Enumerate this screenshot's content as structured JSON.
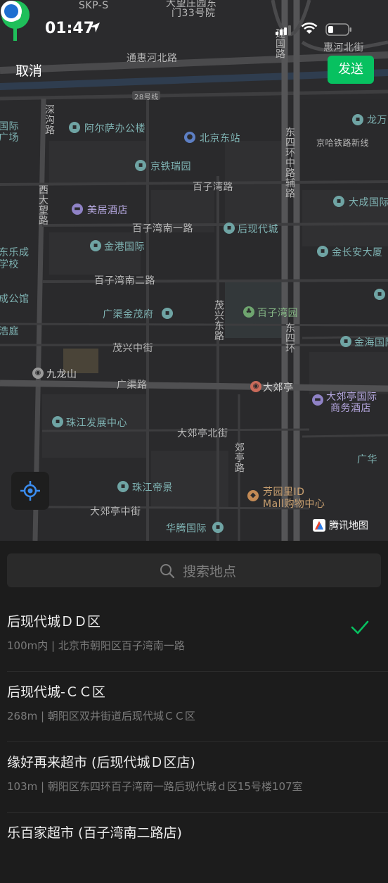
{
  "status_bar": {
    "time": "01:47"
  },
  "header": {
    "cancel_label": "取消",
    "send_label": "发送"
  },
  "map": {
    "logo_text": "腾讯地图",
    "labels": {
      "skp": "SKP-S",
      "dawang": "大望庄园东",
      "men33": "门33号院",
      "jianguo": "建国路",
      "huihe_top": "惠河北街",
      "tonghui": "通惠河北路",
      "line28": "28号线",
      "shengou": "深沟路",
      "guoji_left": "国际广场",
      "alsa": "阿尔萨办公楼",
      "bj_east": "北京东站",
      "dongsihuan_fu": "东四环中路辅路",
      "longwan": "龙万",
      "jingha": "京哈铁路新线",
      "jingtie": "京铁瑞园",
      "baiziwan": "百子湾路",
      "xidawang": "西大望路",
      "meiju": "美居酒店",
      "dacheng": "大成国际",
      "bzw_s1": "百子湾南一路",
      "houxiandai": "后现代城",
      "lecheng": "东乐成",
      "xuexiao": "学校",
      "jingang": "金港国际",
      "jinchang": "金长安大厦",
      "bzw_s2": "百子湾南二路",
      "gongguan": "成公馆",
      "guangqu_jinmao": "广渠金茂府",
      "maoxing_dong": "茂兴东路",
      "bzw_yuan": "百子湾园",
      "dongsihuan": "东四环",
      "haoting": "浩庭",
      "jinhai": "金海国际",
      "maoxing_zhong": "茂兴中街",
      "jiulongshan": "九龙山",
      "guangqu": "广渠路",
      "dajiaoting": "大郊亭",
      "djt_hotel_1": "大郊亭国际",
      "djt_hotel_2": "商务酒店",
      "zhujiang_center": "珠江发展中心",
      "djt_north": "大郊亭北街",
      "jiaoting": "郊亭路",
      "guanghua": "广华",
      "zhujiang_dijing": "珠江帝景",
      "fangyuanli_1": "芳园里ID",
      "fangyuanli_2": "Mall购物中心",
      "djt_middle": "大郊亭中街",
      "huateng": "华腾国际"
    }
  },
  "search": {
    "placeholder": "搜索地点"
  },
  "results": [
    {
      "name": "后现代城ＤＤ区",
      "detail": "100m内 | 北京市朝阳区百子湾南一路"
    },
    {
      "name": "后现代城-ＣＣ区",
      "detail": "268m | 朝阳区双井街道后现代城ＣＣ区"
    },
    {
      "name": "缘好再来超市 (后现代城Ｄ区店)",
      "detail": "103m | 朝阳区东四环百子湾南一路后现代城ｄ区15号楼107室"
    },
    {
      "name": "乐百家超市 (百子湾南二路店)",
      "detail": ""
    }
  ],
  "colors": {
    "accent_green": "#07c160",
    "pin_green": "#1fbf5a",
    "location_blue": "#1e6fd0"
  }
}
